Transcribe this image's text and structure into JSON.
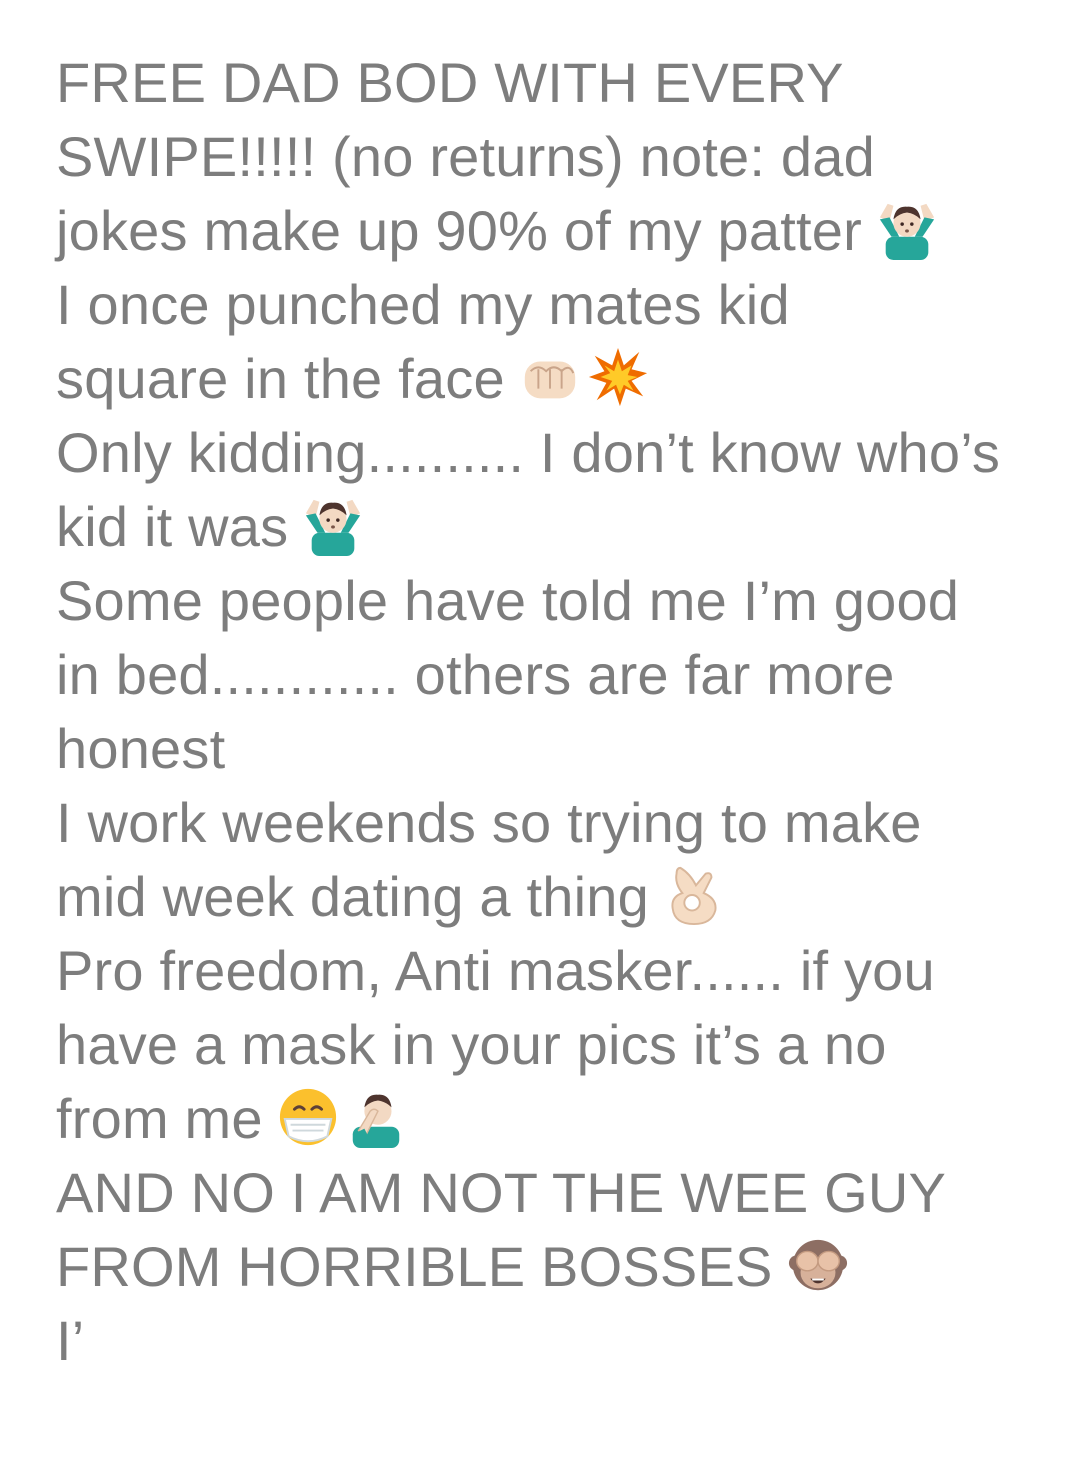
{
  "bio": {
    "lines": [
      {
        "text": "FREE DAD BOD WITH EVERY"
      },
      {
        "text": "SWIPE!!!!! (no returns) note: dad"
      },
      {
        "text": "jokes make up 90% of my patter",
        "icons": [
          "man-shrugging-icon"
        ]
      },
      {
        "text": "I once punched my mates kid"
      },
      {
        "text": "square in the face",
        "icons": [
          "oncoming-fist-icon",
          "collision-icon"
        ]
      },
      {
        "text": "Only kidding.......... I don’t know who’s"
      },
      {
        "text": "kid it was",
        "icons": [
          "man-shrugging-icon"
        ]
      },
      {
        "text": "Some people have told me I’m good"
      },
      {
        "text": "in bed............ others are far more"
      },
      {
        "text": "honest"
      },
      {
        "text": "I work weekends so trying to make"
      },
      {
        "text": "mid week dating a thing",
        "icons": [
          "ok-hand-icon"
        ]
      },
      {
        "text": "Pro freedom, Anti masker...... if you"
      },
      {
        "text": "have a mask in your pics it’s a no"
      },
      {
        "text": "from me",
        "icons": [
          "face-with-medical-mask-icon",
          "man-facepalming-icon"
        ]
      },
      {
        "text": "AND NO I AM NOT THE WEE GUY"
      },
      {
        "text": "FROM HORRIBLE BOSSES",
        "icons": [
          "see-no-evil-monkey-icon"
        ]
      },
      {
        "text": "I’"
      }
    ]
  },
  "colors": {
    "text": "#7d7d7d",
    "background": "#ffffff"
  }
}
